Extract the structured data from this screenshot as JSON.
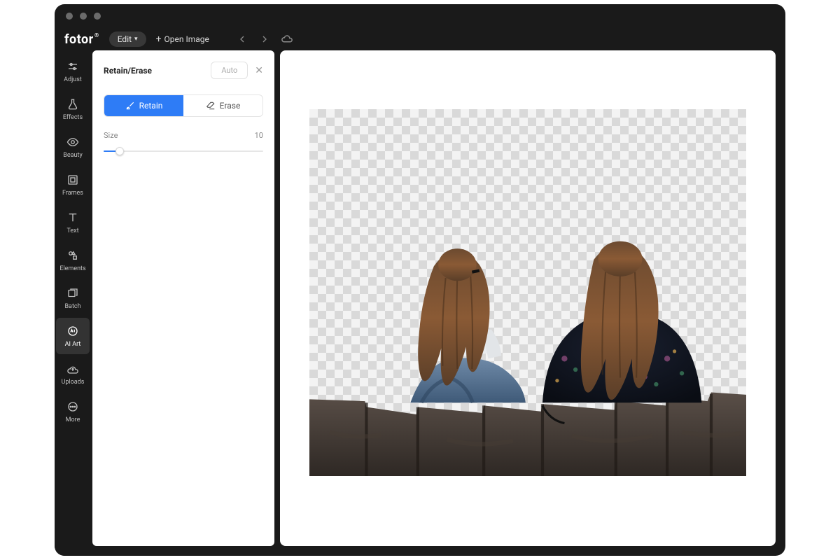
{
  "app": {
    "logo": "fotor"
  },
  "header": {
    "edit_label": "Edit",
    "open_image_label": "Open Image"
  },
  "rail": {
    "items": [
      {
        "id": "adjust",
        "label": "Adjust",
        "icon": "sliders-icon"
      },
      {
        "id": "effects",
        "label": "Effects",
        "icon": "flask-icon"
      },
      {
        "id": "beauty",
        "label": "Beauty",
        "icon": "eye-icon"
      },
      {
        "id": "frames",
        "label": "Frames",
        "icon": "frame-icon"
      },
      {
        "id": "text",
        "label": "Text",
        "icon": "text-icon"
      },
      {
        "id": "elements",
        "label": "Elements",
        "icon": "shapes-icon"
      },
      {
        "id": "batch",
        "label": "Batch",
        "icon": "stack-icon"
      },
      {
        "id": "aiart",
        "label": "AI Art",
        "icon": "ai-icon"
      },
      {
        "id": "uploads",
        "label": "Uploads",
        "icon": "cloud-upload-icon"
      },
      {
        "id": "more",
        "label": "More",
        "icon": "more-icon"
      }
    ],
    "active": "aiart"
  },
  "panel": {
    "title": "Retain/Erase",
    "auto_label": "Auto",
    "tabs": {
      "retain": "Retain",
      "erase": "Erase",
      "active": "retain"
    },
    "size_label": "Size",
    "size_value": "10"
  },
  "canvas": {
    "description": "Two people with long brown hair seated from behind on a dark rocky wall; background removed (transparent checker)."
  },
  "colors": {
    "accent": "#2e7cf6",
    "window_bg": "#1a1a1a"
  }
}
